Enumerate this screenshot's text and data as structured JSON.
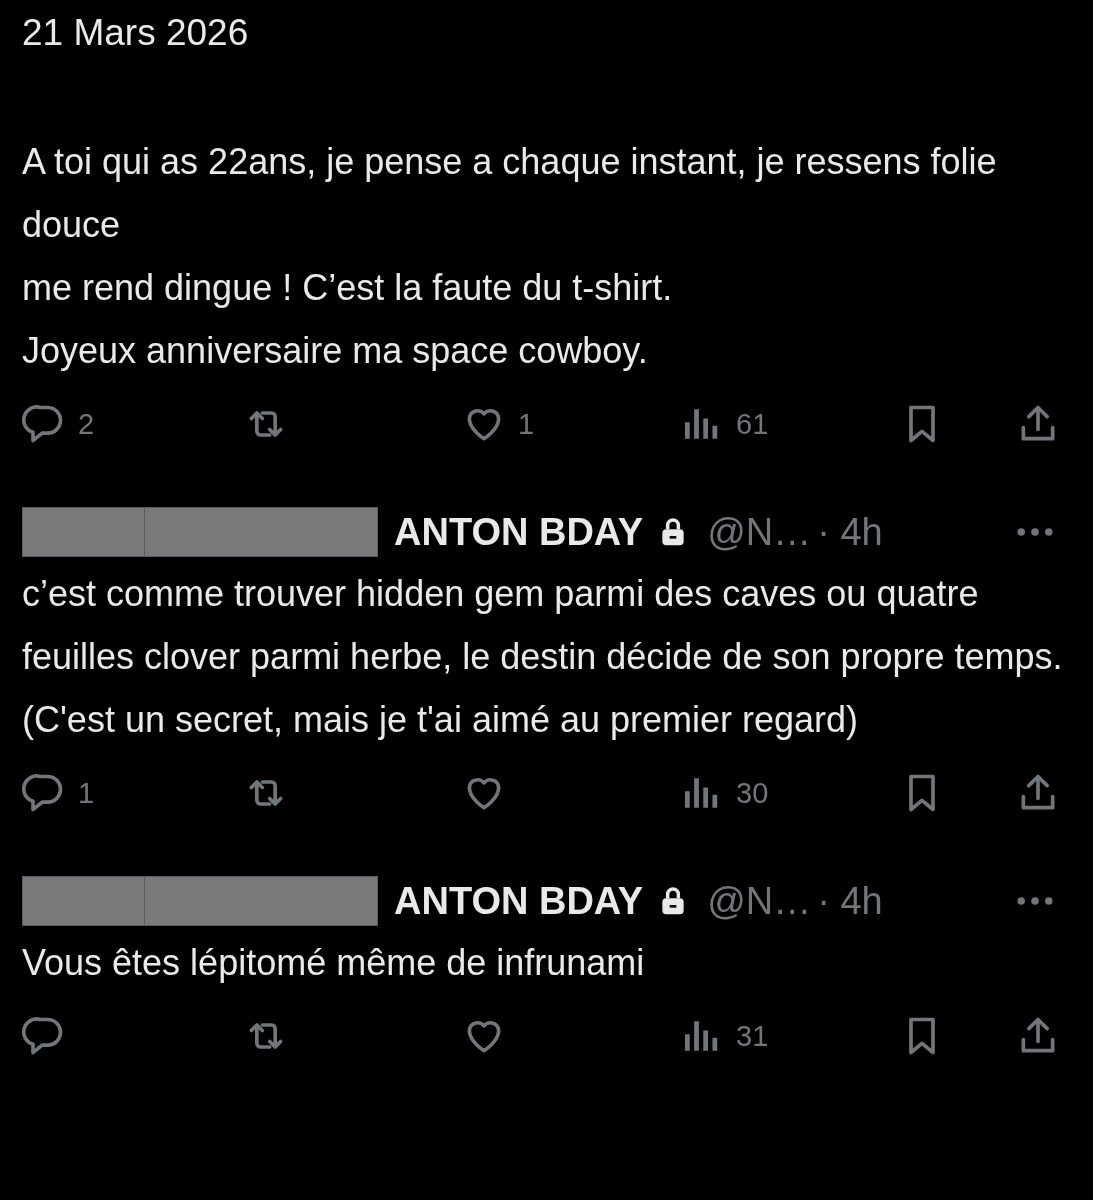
{
  "date": "21 Mars 2026",
  "post": {
    "text": "A toi qui as 22ans, je pense a chaque instant, je ressens folie douce\nme rend dingue ! C’est la faute du t-shirt.\nJoyeux anniversaire ma space cowboy.",
    "actions": [
      {
        "kind": "reply",
        "count": "2"
      },
      {
        "kind": "repost"
      },
      {
        "kind": "like",
        "count": "1"
      },
      {
        "kind": "views",
        "count": "61"
      },
      {
        "kind": "bookmark"
      },
      {
        "kind": "share"
      }
    ]
  },
  "replies": [
    {
      "name": "ANTON BDAY",
      "protected": true,
      "handle": "@N…",
      "time": "· 4h",
      "text": "c’est comme trouver hidden gem parmi des caves ou quatre feuilles clover parmi herbe, le destin décide de son propre temps. (C'est un secret, mais je t'ai aimé au premier regard)",
      "actions": [
        {
          "kind": "reply",
          "count": "1"
        },
        {
          "kind": "repost"
        },
        {
          "kind": "like"
        },
        {
          "kind": "views",
          "count": "30"
        },
        {
          "kind": "bookmark"
        },
        {
          "kind": "share"
        }
      ]
    },
    {
      "name": "ANTON BDAY",
      "protected": true,
      "handle": "@N…",
      "time": "· 4h",
      "text": "Vous êtes lépitomé même de infrunami",
      "actions": [
        {
          "kind": "reply"
        },
        {
          "kind": "repost"
        },
        {
          "kind": "like"
        },
        {
          "kind": "views",
          "count": "31"
        },
        {
          "kind": "bookmark"
        },
        {
          "kind": "share"
        }
      ]
    }
  ]
}
